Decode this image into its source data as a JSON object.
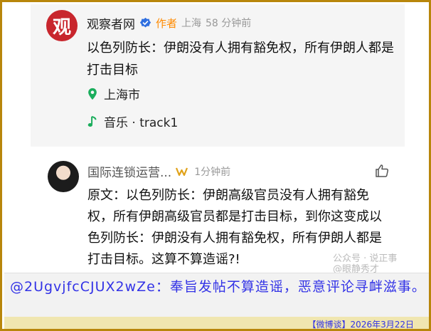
{
  "post": {
    "avatar_char": "观",
    "author": "观察者网",
    "tag": "作者",
    "location_meta": "上海",
    "time": "58 分钟前",
    "text": "以色列防长：伊朗没有人拥有豁免权，所有伊朗人都是打击目标",
    "location": "上海市",
    "music": "音乐 · track1"
  },
  "comment": {
    "author": "国际连锁运营...",
    "time": "1分钟前",
    "text": "原文：以色列防长：伊朗高级官员没有人拥有豁免权，所有伊朗高级官员都是打击目标，到你这变成以色列防长：伊朗没有人拥有豁免权，所有伊朗人都是打击目标。这算不算造谣?!"
  },
  "watermark": {
    "line1": "公众号 · 说正事",
    "line2": "@眼静秀才"
  },
  "caption": "@2UgvjfcCJUX2wZe：奉旨发帖不算造谣，恶意评论寻衅滋事。",
  "footer": "【微博谈】2026年3月22日",
  "colors": {
    "frame": "#b8860b",
    "caption_text": "#3232e6",
    "footer_bg": "#f0e6b0",
    "author_tag": "#ff8a00",
    "location_pin": "#1aad5c",
    "verified": "#2f6fe0"
  },
  "icons": [
    "verified-icon",
    "location-pin-icon",
    "music-note-icon",
    "w-badge-icon",
    "like-icon"
  ]
}
